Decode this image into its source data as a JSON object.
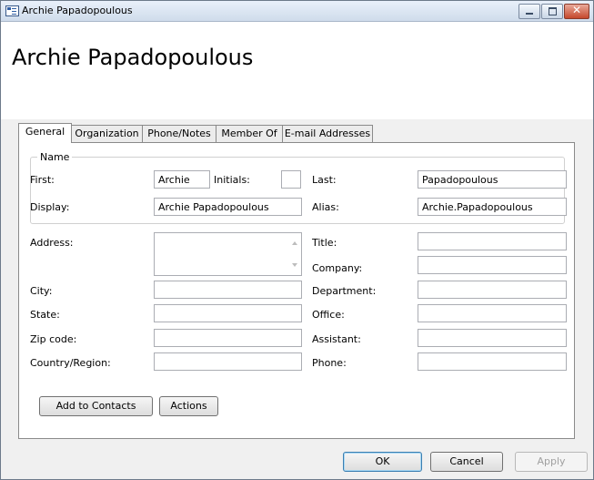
{
  "window": {
    "title": "Archie Papadopoulous"
  },
  "header": {
    "name": "Archie Papadopoulous"
  },
  "tabs": [
    "General",
    "Organization",
    "Phone/Notes",
    "Member Of",
    "E-mail Addresses"
  ],
  "name_group": {
    "legend": "Name",
    "first_label": "First:",
    "first_value": "Archie",
    "initials_label": "Initials:",
    "initials_value": "",
    "last_label": "Last:",
    "last_value": "Papadopoulous",
    "display_label": "Display:",
    "display_value": "Archie Papadopoulous",
    "alias_label": "Alias:",
    "alias_value": "Archie.Papadopoulous"
  },
  "address": {
    "address_label": "Address:",
    "address_value": "",
    "city_label": "City:",
    "city_value": "",
    "state_label": "State:",
    "state_value": "",
    "zip_label": "Zip code:",
    "zip_value": "",
    "country_label": "Country/Region:",
    "country_value": ""
  },
  "organization": {
    "title_label": "Title:",
    "title_value": "",
    "company_label": "Company:",
    "company_value": "",
    "department_label": "Department:",
    "department_value": "",
    "office_label": "Office:",
    "office_value": "",
    "assistant_label": "Assistant:",
    "assistant_value": "",
    "phone_label": "Phone:",
    "phone_value": ""
  },
  "panel_buttons": {
    "add_to_contacts": "Add to Contacts",
    "actions": "Actions"
  },
  "dialog_buttons": {
    "ok": "OK",
    "cancel": "Cancel",
    "apply": "Apply"
  }
}
